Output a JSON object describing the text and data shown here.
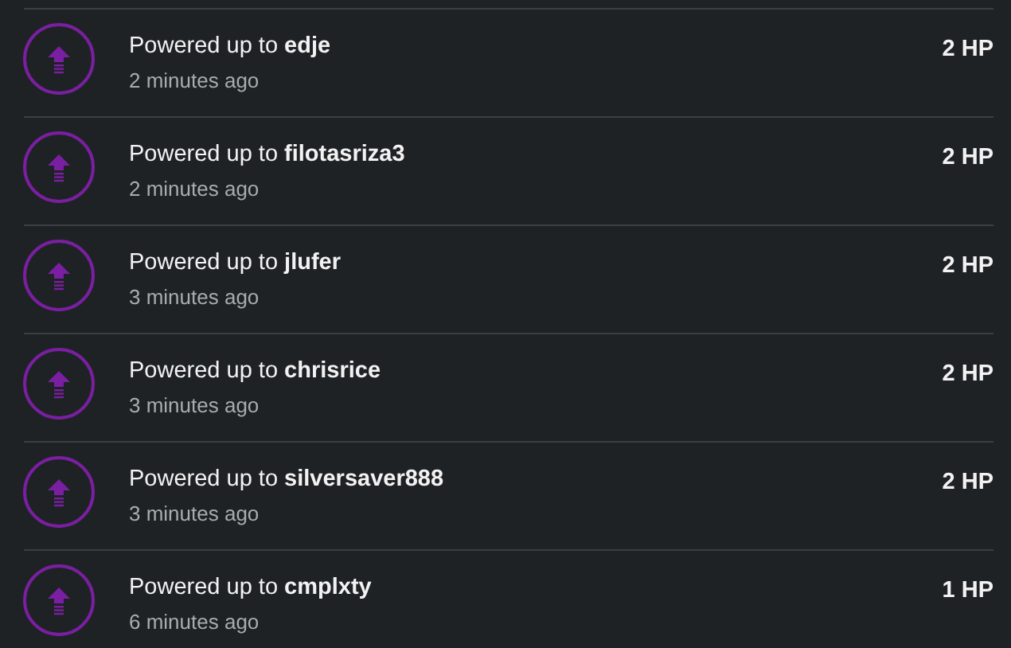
{
  "activities": [
    {
      "title": "Powered up to **edje**",
      "time": "2 minutes ago",
      "amount": "2 HP"
    },
    {
      "title": "Powered up to **filotasriza3**",
      "time": "2 minutes ago",
      "amount": "2 HP"
    },
    {
      "title": "Powered up to **jlufer**",
      "time": "3 minutes ago",
      "amount": "2 HP"
    },
    {
      "title": "Powered up to **chrisrice**",
      "time": "3 minutes ago",
      "amount": "2 HP"
    },
    {
      "title": "Powered up to **silversaver888**",
      "time": "3 minutes ago",
      "amount": "2 HP"
    },
    {
      "title": "Powered up to **cmplxty**",
      "time": "6 minutes ago",
      "amount": "1 HP"
    }
  ]
}
